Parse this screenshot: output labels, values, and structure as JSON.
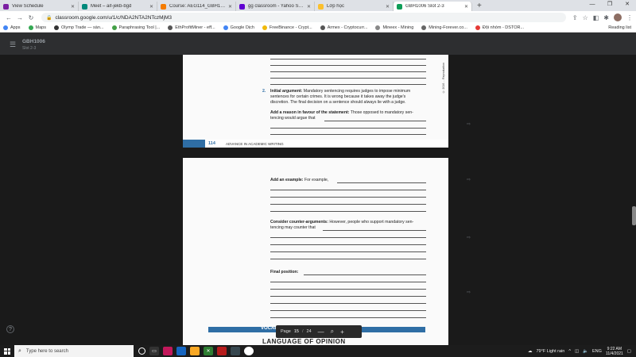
{
  "tabs": [
    {
      "label": "View Schedule",
      "color": "#7b1fa2",
      "active": false
    },
    {
      "label": "Meet – aif-jekb-bgd",
      "color": "#00897b",
      "active": false
    },
    {
      "label": "Course: AEG114_GBH1006",
      "color": "#f57c00",
      "active": false
    },
    {
      "label": "gg classroom - Yahoo Search Re",
      "color": "#6001d2",
      "active": false
    },
    {
      "label": "Lớp học",
      "color": "#fbc02d",
      "active": false
    },
    {
      "label": "GBH1006 Slot 2-3",
      "color": "#0f9d58",
      "active": true
    }
  ],
  "address": {
    "url": "classroom.google.com/u/1/c/NDA2NTA2NTczMjM3"
  },
  "bookmarks": [
    {
      "label": "Apps",
      "color": "#4285f4"
    },
    {
      "label": "Maps",
      "color": "#34a853"
    },
    {
      "label": "Olymp Trade — sàn...",
      "color": "#333333"
    },
    {
      "label": "Paraphrasing Tool |...",
      "color": "#43a047"
    },
    {
      "label": "EthProfitMiner - eff...",
      "color": "#555555"
    },
    {
      "label": "Google Dịch",
      "color": "#4285f4"
    },
    {
      "label": "FreeBinance - Crypt...",
      "color": "#f0b90b"
    },
    {
      "label": "Armex - Cryptocurr...",
      "color": "#555555"
    },
    {
      "label": "Mineex - Mining",
      "color": "#888888"
    },
    {
      "label": "Mining-Forever.co...",
      "color": "#666666"
    },
    {
      "label": "Đội nhóm - DSTOR...",
      "color": "#e53935"
    }
  ],
  "reading_list": "Reading list",
  "classroom": {
    "name": "GBH1006",
    "subtitle": "Slot 2-3"
  },
  "page1": {
    "item_number": "2.",
    "initial_label": "Initial argument:",
    "initial_text1": " Mandatory sentencing requires judges to impose minimum",
    "initial_text2": "sentences for certain crimes. It is wrong because it takes away the judge's",
    "initial_text3": "discretion. The final decision on a sentence should always lie with a judge.",
    "reason_label": "Add a reason in favour of the statement:",
    "reason_text1": " Those opposed to mandatory sen-",
    "reason_text2": "tencing would argue that",
    "page_number": "114",
    "book_title": "ADVANCE IN ACADEMIC WRITING",
    "copyright": "© 2016 ... Reproduction"
  },
  "page2": {
    "example_label": "Add an example:",
    "example_text": " For example,",
    "counter_label": "Consider counter-arguments:",
    "counter_text1": " However, people who support mandatory sen-",
    "counter_text2": "tencing may counter that",
    "final_label": "Final position:"
  },
  "vocab_heading": "VOCAB",
  "language_heading": "LANGUAGE OF OPINION",
  "page_control": {
    "label": "Page",
    "current": "15",
    "separator": "/",
    "total": "24"
  },
  "taskbar": {
    "search_placeholder": "Type here to search",
    "weather": "79°F  Light rain",
    "lang": "ENG",
    "time": "9:22 AM",
    "date": "11/4/2021"
  }
}
